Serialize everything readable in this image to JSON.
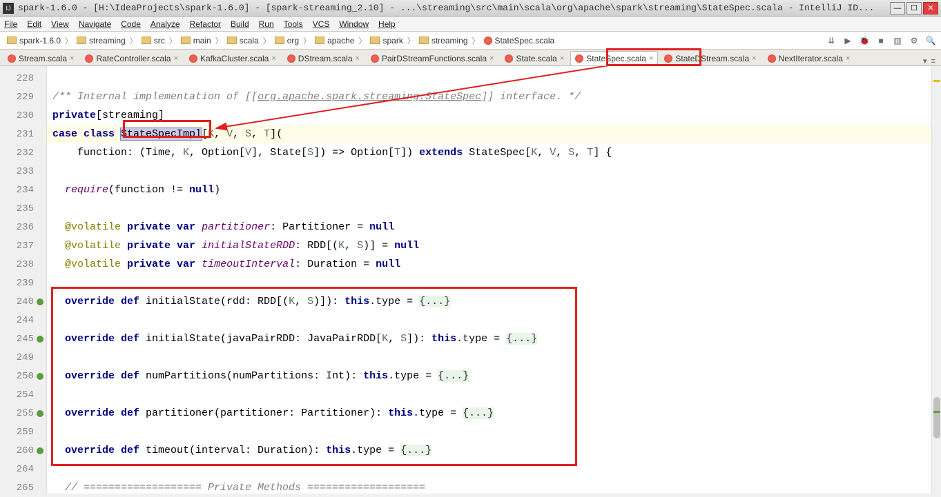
{
  "window": {
    "title": "spark-1.6.0 - [H:\\IdeaProjects\\spark-1.6.0] - [spark-streaming_2.10] - ...\\streaming\\src\\main\\scala\\org\\apache\\spark\\streaming\\StateSpec.scala - IntelliJ ID..."
  },
  "menu": [
    "File",
    "Edit",
    "View",
    "Navigate",
    "Code",
    "Analyze",
    "Refactor",
    "Build",
    "Run",
    "Tools",
    "VCS",
    "Window",
    "Help"
  ],
  "breadcrumb": [
    {
      "type": "folder",
      "label": "spark-1.6.0"
    },
    {
      "type": "folder",
      "label": "streaming"
    },
    {
      "type": "folder",
      "label": "src"
    },
    {
      "type": "folder",
      "label": "main"
    },
    {
      "type": "folder",
      "label": "scala"
    },
    {
      "type": "folder",
      "label": "org"
    },
    {
      "type": "folder",
      "label": "apache"
    },
    {
      "type": "folder",
      "label": "spark"
    },
    {
      "type": "folder",
      "label": "streaming"
    },
    {
      "type": "file",
      "label": "StateSpec.scala"
    }
  ],
  "tabs": [
    {
      "label": "Stream.scala",
      "active": false
    },
    {
      "label": "RateController.scala",
      "active": false
    },
    {
      "label": "KafkaCluster.scala",
      "active": false
    },
    {
      "label": "DStream.scala",
      "active": false
    },
    {
      "label": "PairDStreamFunctions.scala",
      "active": false
    },
    {
      "label": "State.scala",
      "active": false
    },
    {
      "label": "StateSpec.scala",
      "active": true
    },
    {
      "label": "StateDStream.scala",
      "active": false
    },
    {
      "label": "NextIterator.scala",
      "active": false
    }
  ],
  "gutter_lines": [
    "228",
    "229",
    "230",
    "231",
    "232",
    "233",
    "234",
    "235",
    "236",
    "237",
    "238",
    "239",
    "240",
    "244",
    "245",
    "249",
    "250",
    "254",
    "255",
    "259",
    "260",
    "264",
    "265"
  ],
  "override_rows": [
    12,
    14,
    16,
    18,
    20
  ],
  "code": {
    "l228": "",
    "l229_pre": "/** Internal implementation of [[",
    "l229_link": "org.apache.spark.streaming.StateSpec",
    "l229_post": "]] interface. */",
    "l230_kw1": "private",
    "l230_rest": "[streaming]",
    "l231_kw": "case class ",
    "l231_name": "StateSpecImpl",
    "l231_rest_open": "[",
    "l231_K": "K",
    "l231_c1": ", ",
    "l231_V": "V",
    "l231_c2": ", ",
    "l231_S": "S",
    "l231_c3": ", ",
    "l231_T": "T",
    "l231_rest_close": "](",
    "l232_pre": "    function: (Time, ",
    "l232_K": "K",
    "l232_mid1": ", Option[",
    "l232_V": "V",
    "l232_mid2": "], State[",
    "l232_S": "S",
    "l232_mid3": "]) => Option[",
    "l232_T": "T",
    "l232_mid4": "]) ",
    "l232_ext": "extends",
    "l232_post": " StateSpec[",
    "l232_K2": "K",
    "l232_c1": ", ",
    "l232_V2": "V",
    "l232_c2": ", ",
    "l232_S2": "S",
    "l232_c3": ", ",
    "l232_T2": "T",
    "l232_end": "] {",
    "l234_req": "  require",
    "l234_rest": "(function != ",
    "l234_null": "null",
    "l234_end": ")",
    "l236_ann": "  @volatile ",
    "l236_priv": "private var ",
    "l236_field": "partitioner",
    "l236_rest": ": Partitioner = ",
    "l236_null": "null",
    "l237_ann": "  @volatile ",
    "l237_priv": "private var ",
    "l237_field": "initialStateRDD",
    "l237_rest": ": RDD[(",
    "l237_K": "K",
    "l237_c": ", ",
    "l237_S": "S",
    "l237_rest2": ")] = ",
    "l237_null": "null",
    "l238_ann": "  @volatile ",
    "l238_priv": "private var ",
    "l238_field": "timeoutInterval",
    "l238_rest": ": Duration = ",
    "l238_null": "null",
    "l240_ov": "  override def ",
    "l240_name": "initialState(rdd: RDD[(",
    "l240_K": "K",
    "l240_c": ", ",
    "l240_S": "S",
    "l240_rest": ")]): ",
    "l240_this": "this",
    "l240_type": ".type = ",
    "l240_fold": "{...}",
    "l245_ov": "  override def ",
    "l245_name": "initialState(javaPairRDD: JavaPairRDD[",
    "l245_K": "K",
    "l245_c": ", ",
    "l245_S": "S",
    "l245_rest": "]): ",
    "l245_this": "this",
    "l245_type": ".type = ",
    "l245_fold": "{...}",
    "l250_ov": "  override def ",
    "l250_name": "numPartitions(numPartitions: Int): ",
    "l250_this": "this",
    "l250_type": ".type = ",
    "l250_fold": "{...}",
    "l255_ov": "  override def ",
    "l255_name": "partitioner(partitioner: Partitioner): ",
    "l255_this": "this",
    "l255_type": ".type = ",
    "l255_fold": "{...}",
    "l260_ov": "  override def ",
    "l260_name": "timeout(interval: Duration): ",
    "l260_this": "this",
    "l260_type": ".type = ",
    "l260_fold": "{...}",
    "l265": "  // =================== Private Methods ==================="
  }
}
